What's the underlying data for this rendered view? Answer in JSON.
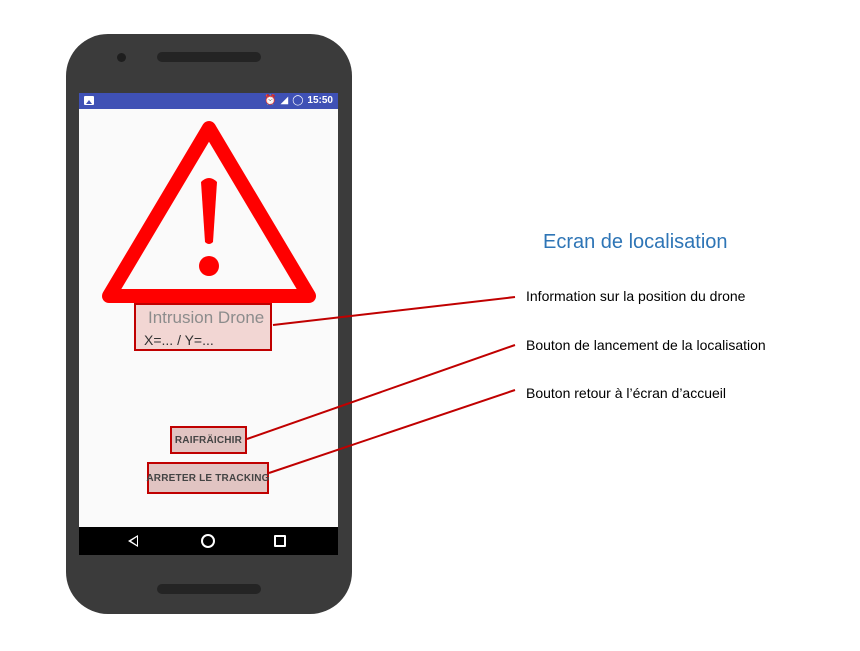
{
  "status_bar": {
    "time": "15:50",
    "icons": [
      "image-icon",
      "alarm-icon",
      "signal-icon",
      "sync-icon"
    ]
  },
  "alert": {
    "icon": "warning-icon",
    "title": "Intrusion Drone",
    "coords": "X=... / Y=..."
  },
  "buttons": {
    "refresh_label": "RAIFRÄICHIR",
    "stop_label": "ARRETER LE TRACKING"
  },
  "nav_bar": {
    "icons": [
      "back-icon",
      "home-icon",
      "recent-apps-icon"
    ]
  },
  "annotation": {
    "title": "Ecran de localisation",
    "callouts": [
      "Information sur la position du drone",
      "Bouton de lancement de la localisation",
      "Bouton retour à l’écran d’accueil"
    ]
  },
  "colors": {
    "status_bar": "#3f51b5",
    "warning_red": "#ff0000",
    "highlight_border": "#c00000",
    "title_blue": "#2e75b6",
    "phone_body": "#3b3b3b"
  }
}
